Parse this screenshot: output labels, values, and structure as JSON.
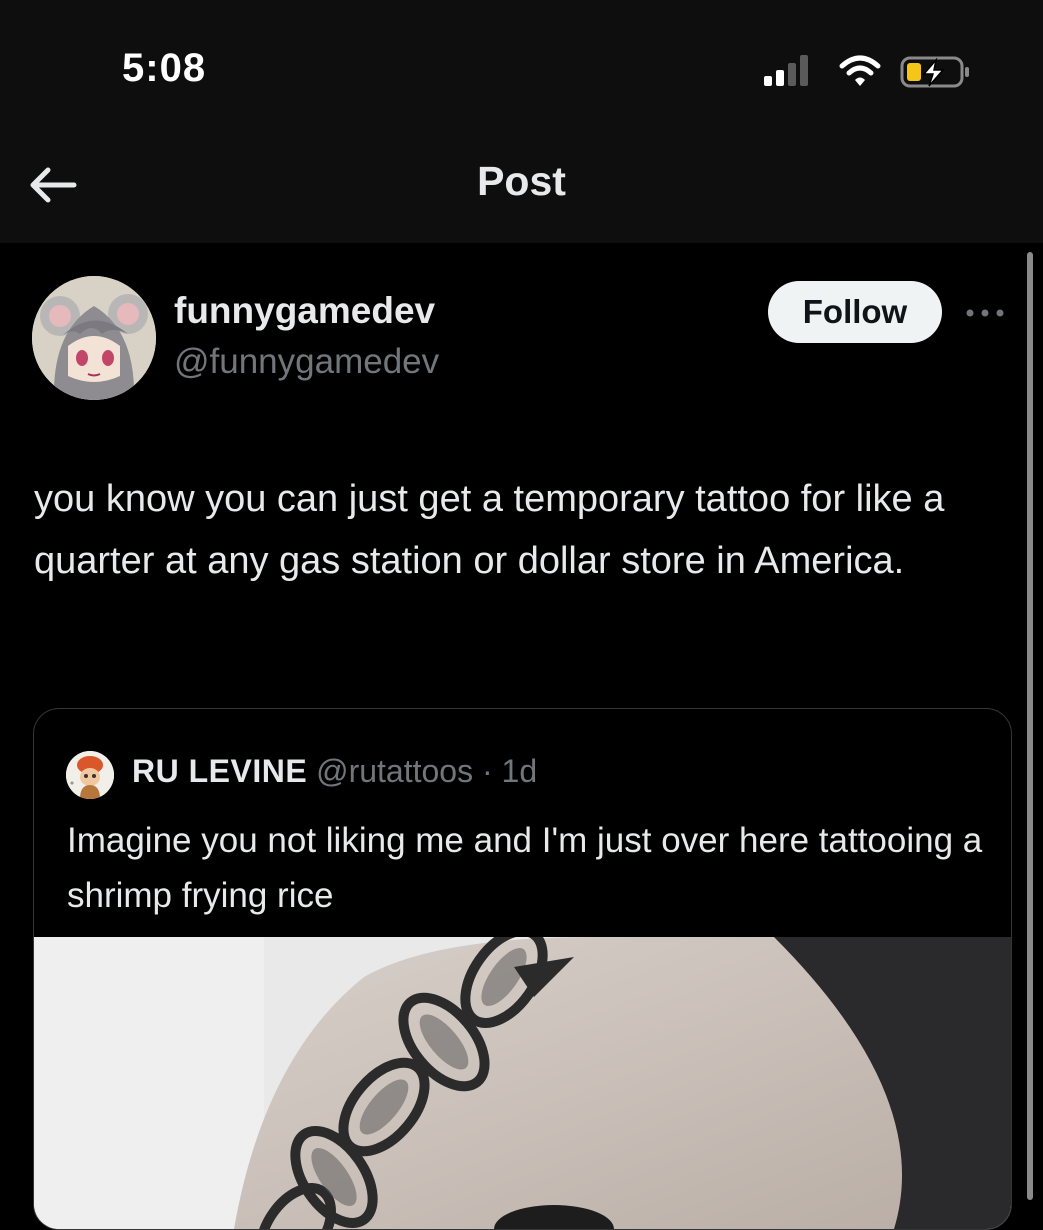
{
  "status_bar": {
    "time": "5:08"
  },
  "header": {
    "title": "Post"
  },
  "post": {
    "author": {
      "display_name": "funnygamedev",
      "handle": "@funnygamedev"
    },
    "follow_label": "Follow",
    "text": "you know you can just get a temporary tattoo for like a quarter at any gas station or dollar store in America."
  },
  "quoted_post": {
    "author": {
      "display_name": "RU LEVINE",
      "handle": "@rutattoos"
    },
    "separator": "·",
    "time": "1d",
    "text": "Imagine you not liking me and I'm just over here tattooing a shrimp frying rice"
  },
  "icons": {
    "back": "arrow-left-icon",
    "more": "more-dots-icon",
    "signal": "cellular-signal-icon",
    "wifi": "wifi-icon",
    "battery": "battery-charging-icon"
  },
  "colors": {
    "background": "#000000",
    "header_bg": "#0e0e0e",
    "text_primary": "#e7e9ea",
    "text_secondary": "#71767b",
    "follow_bg": "#eff3f4",
    "battery_fill": "#f5c518"
  }
}
